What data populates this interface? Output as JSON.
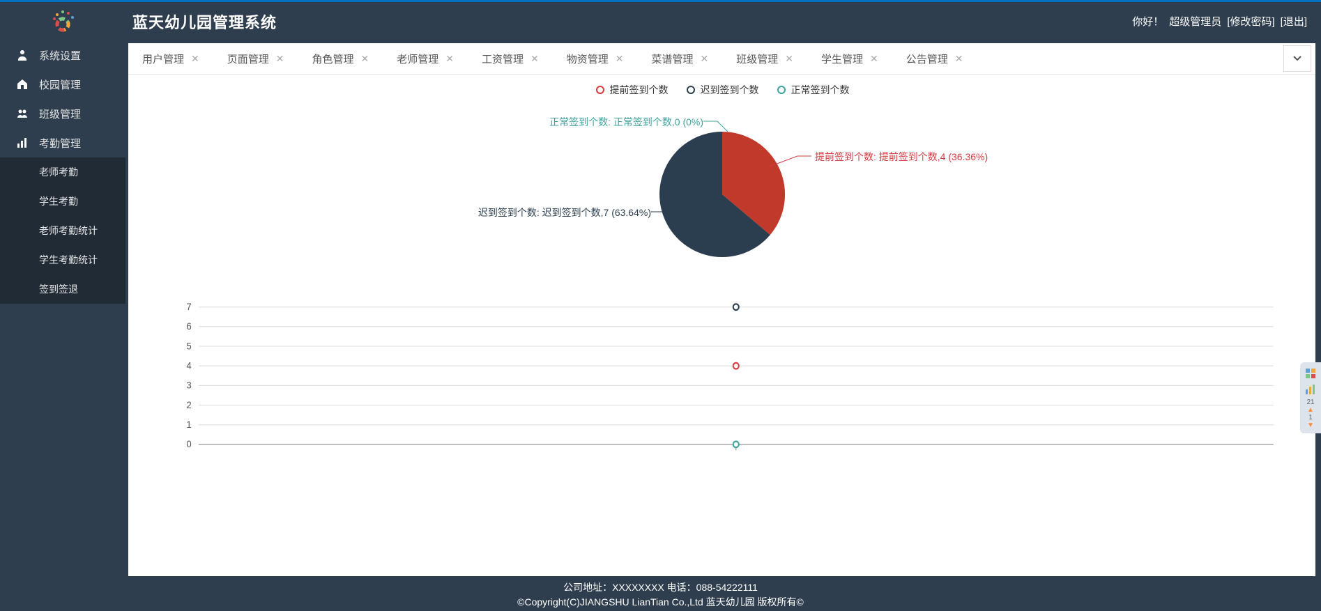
{
  "header": {
    "app_title": "蓝天幼儿园管理系统",
    "greeting": "你好！",
    "user_role": "超级管理员",
    "change_password": "[修改密码]",
    "logout": "[退出]"
  },
  "sidebar": {
    "items": [
      {
        "label": "系统设置",
        "icon": "user-icon"
      },
      {
        "label": "校园管理",
        "icon": "home-icon"
      },
      {
        "label": "班级管理",
        "icon": "group-icon"
      },
      {
        "label": "考勤管理",
        "icon": "chart-icon"
      }
    ],
    "sub_items": [
      {
        "label": "老师考勤"
      },
      {
        "label": "学生考勤"
      },
      {
        "label": "老师考勤统计"
      },
      {
        "label": "学生考勤统计"
      },
      {
        "label": "签到签退"
      }
    ]
  },
  "tabs": [
    {
      "label": "用户管理"
    },
    {
      "label": "页面管理"
    },
    {
      "label": "角色管理"
    },
    {
      "label": "老师管理"
    },
    {
      "label": "工资管理"
    },
    {
      "label": "物资管理"
    },
    {
      "label": "菜谱管理"
    },
    {
      "label": "班级管理"
    },
    {
      "label": "学生管理"
    },
    {
      "label": "公告管理"
    }
  ],
  "chart_data": [
    {
      "type": "pie",
      "title": "",
      "legend": [
        {
          "name": "提前签到个数",
          "color": "#D73A3F"
        },
        {
          "name": "迟到签到个数",
          "color": "#2B3E50"
        },
        {
          "name": "正常签到个数",
          "color": "#3EA39E"
        }
      ],
      "series": [
        {
          "name": "提前签到个数",
          "label_full": "提前签到个数: 提前签到个数,4 (36.36%)",
          "value": 4,
          "percent": 36.36,
          "color": "#D73A3F"
        },
        {
          "name": "迟到签到个数",
          "label_full": "迟到签到个数: 迟到签到个数,7 (63.64%)",
          "value": 7,
          "percent": 63.64,
          "color": "#2B3E50"
        },
        {
          "name": "正常签到个数",
          "label_full": "正常签到个数: 正常签到个数,0 (0%)",
          "value": 0,
          "percent": 0,
          "color": "#3EA39E"
        }
      ]
    },
    {
      "type": "line",
      "series": [
        {
          "name": "提前签到个数",
          "color": "#D73A3F",
          "values": [
            4
          ]
        },
        {
          "name": "迟到签到个数",
          "color": "#2B3E50",
          "values": [
            7
          ]
        },
        {
          "name": "正常签到个数",
          "color": "#3EA39E",
          "values": [
            0
          ]
        }
      ],
      "ylim": [
        0,
        7
      ],
      "yticks": [
        0,
        1,
        2,
        3,
        4,
        5,
        6,
        7
      ],
      "x_categories": [
        ""
      ]
    }
  ],
  "footer": {
    "line1": "公司地址：XXXXXXXX 电话：088-54222111",
    "line2": "©Copyright(C)JIANGSHU LianTian Co.,Ltd 蓝天幼儿园 版权所有©"
  },
  "side_widget": {
    "num1": "21",
    "num2": "1"
  },
  "colors": {
    "brand_bg": "#2F3E4E",
    "red": "#D73A3F",
    "dark": "#2B3E50",
    "teal": "#3EA39E"
  }
}
